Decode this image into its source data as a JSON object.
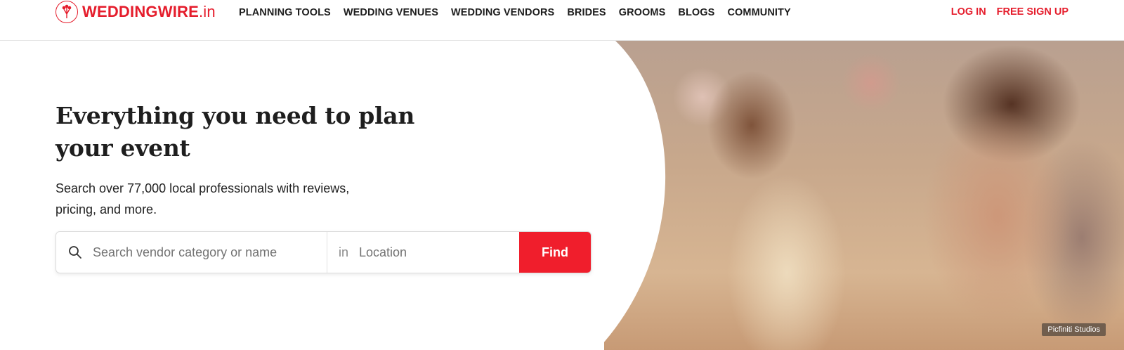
{
  "brand": {
    "name": "WEDDINGWIRE",
    "tld": ".in",
    "accent": "#e51d2c",
    "icon": "bouquet-logo-icon"
  },
  "nav": {
    "items": [
      {
        "label": "PLANNING TOOLS"
      },
      {
        "label": "WEDDING VENUES"
      },
      {
        "label": "WEDDING VENDORS"
      },
      {
        "label": "BRIDES"
      },
      {
        "label": "GROOMS"
      },
      {
        "label": "BLOGS"
      },
      {
        "label": "COMMUNITY"
      }
    ]
  },
  "auth": {
    "login_label": "LOG IN",
    "signup_label": "FREE SIGN UP"
  },
  "hero": {
    "title": "Everything you need to plan your event",
    "subtitle": "Search over 77,000 local professionals with reviews, pricing, and more.",
    "photo_credit": "Picfiniti Studios"
  },
  "search": {
    "query_placeholder": "Search vendor category or name",
    "query_value": "",
    "location_prefix": "in",
    "location_placeholder": "Location",
    "location_value": "",
    "button_label": "Find",
    "button_color": "#f01e2c",
    "icon": "search-icon"
  }
}
